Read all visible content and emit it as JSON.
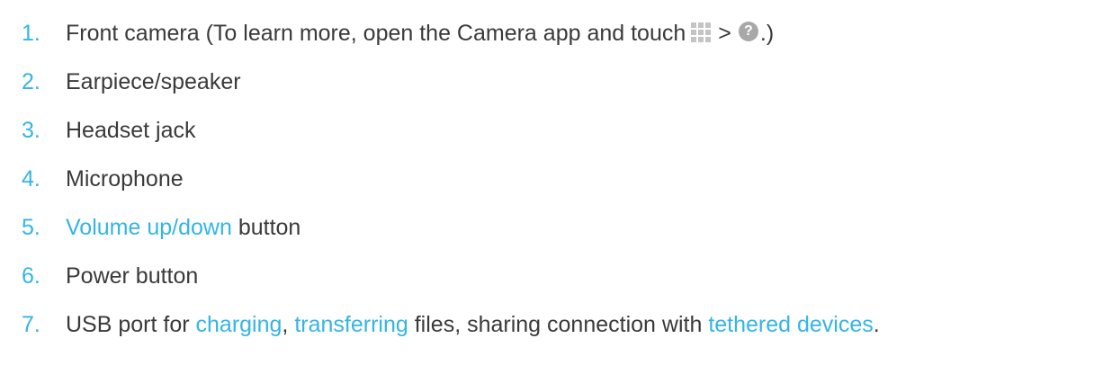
{
  "items": [
    {
      "number": "1.",
      "text_before": "Front camera (To learn more, open the Camera app and touch",
      "separator": ">",
      "text_after": ".)",
      "icons": [
        "apps-grid-icon",
        "help-icon"
      ],
      "help_glyph": "?"
    },
    {
      "number": "2.",
      "text": "Earpiece/speaker"
    },
    {
      "number": "3.",
      "text": "Headset jack"
    },
    {
      "number": "4.",
      "text": "Microphone"
    },
    {
      "number": "5.",
      "link": "Volume up/down",
      "text": "button"
    },
    {
      "number": "6.",
      "text": "Power button"
    },
    {
      "number": "7.",
      "text_1": "USB port for",
      "link_1": "charging",
      "sep_1": ",",
      "link_2": "transferring",
      "text_2": "files, sharing connection with",
      "link_3": "tethered devices",
      "end": "."
    }
  ],
  "colors": {
    "accent": "#33b5e5",
    "text": "#3a3a3a",
    "icon_grid": "#c4c4c4",
    "icon_help": "#a8a8a8"
  }
}
